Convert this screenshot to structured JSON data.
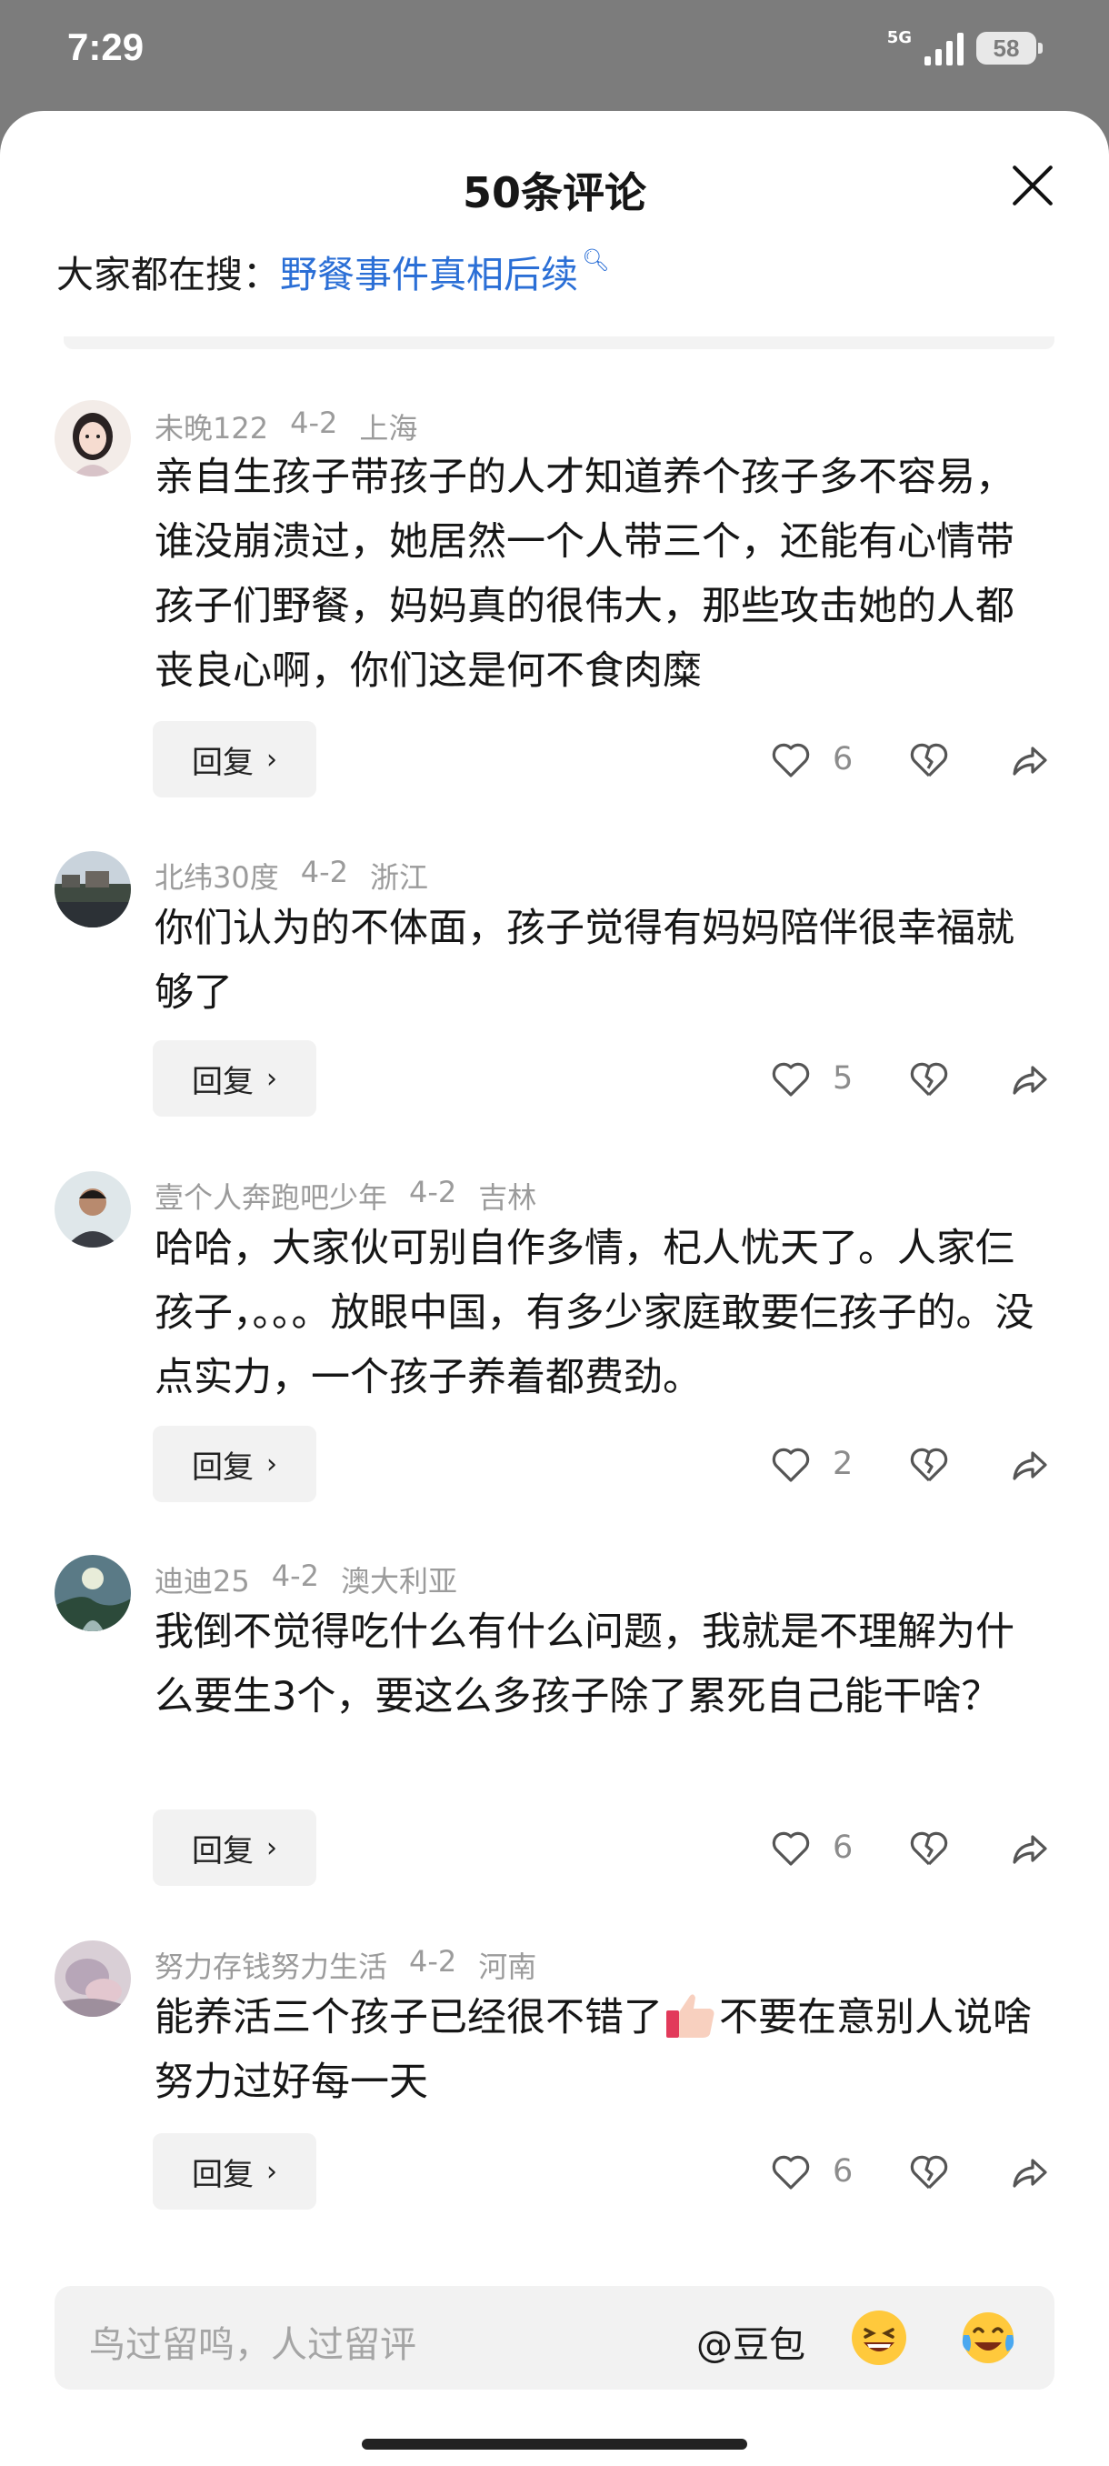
{
  "status_bar": {
    "time": "7:29",
    "network": "5G",
    "battery": "58"
  },
  "sheet": {
    "title": "50条评论",
    "search_prefix": "大家都在搜：",
    "search_term": "野餐事件真相后续"
  },
  "comments": [
    {
      "user": "未晚122",
      "date": "4-2",
      "location": "上海",
      "text": "亲自生孩子带孩子的人才知道养个孩子多不容易，谁没崩溃过，她居然一个人带三个，还能有心情带孩子们野餐，妈妈真的很伟大，那些攻击她的人都丧良心啊，你们这是何不食肉糜",
      "likes": "6",
      "reply_label": "回复"
    },
    {
      "user": "北纬30度",
      "date": "4-2",
      "location": "浙江",
      "text": "你们认为的不体面，孩子觉得有妈妈陪伴很幸福就够了",
      "likes": "5",
      "reply_label": "回复"
    },
    {
      "user": "壹个人奔跑吧少年",
      "date": "4-2",
      "location": "吉林",
      "text": "哈哈，大家伙可别自作多情，杞人忧天了。人家仨孩子，。。。放眼中国，有多少家庭敢要仨孩子的。没点实力，一个孩子养着都费劲。",
      "likes": "2",
      "reply_label": "回复"
    },
    {
      "user": "迪迪25",
      "date": "4-2",
      "location": "澳大利亚",
      "text": "我倒不觉得吃什么有什么问题，我就是不理解为什么要生3个，要这么多孩子除了累死自己能干啥？",
      "likes": "6",
      "reply_label": "回复"
    },
    {
      "user": "努力存钱努力生活",
      "date": "4-2",
      "location": "河南",
      "text_before": "能养活三个孩子已经很不错了",
      "text_after": "不要在意别人说啥努力过好每一天",
      "likes": "6",
      "reply_label": "回复"
    }
  ],
  "input": {
    "placeholder": "鸟过留鸣，人过留评",
    "at_label": "@豆包"
  },
  "icons": {
    "like": "heart-outline-icon",
    "dislike": "broken-heart-icon",
    "share": "share-arrow-icon",
    "close": "close-icon",
    "search": "search-icon",
    "emoji_laugh": "grinning-emoji-icon",
    "emoji_cry": "tears-of-joy-emoji-icon",
    "thumbs_up": "thumbs-up-emoji-icon"
  },
  "colors": {
    "link": "#2b6fd6",
    "meta": "#9b9b9b",
    "status_bg": "#7c7c7c"
  }
}
